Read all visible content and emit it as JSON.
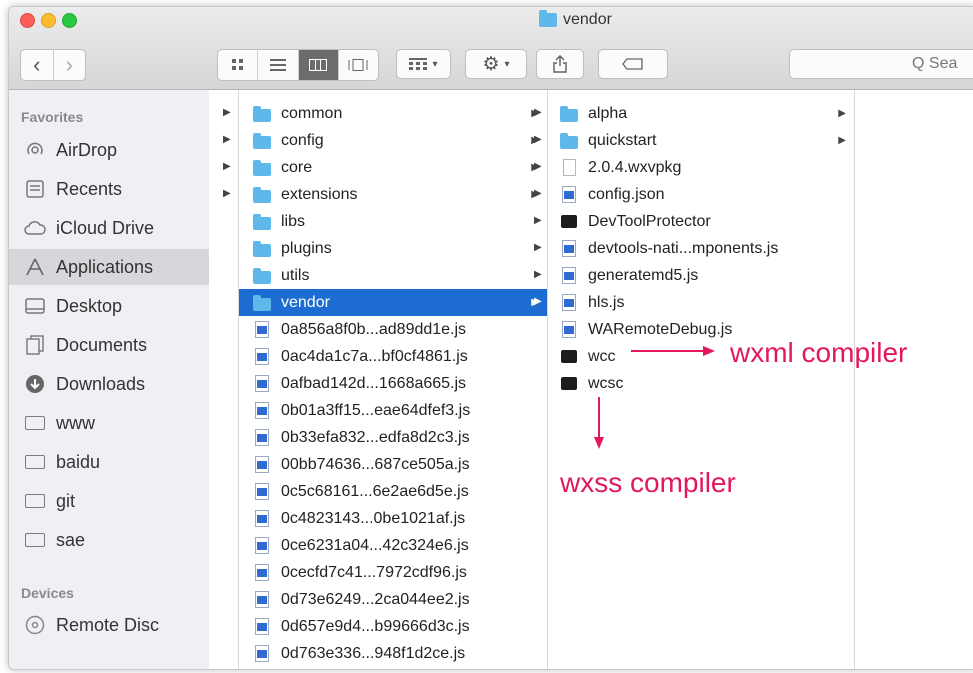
{
  "window": {
    "title": "vendor"
  },
  "toolbar": {
    "back_label": "‹",
    "forward_label": "›",
    "search_placeholder": "Q Sea"
  },
  "sidebar": {
    "favorites_header": "Favorites",
    "devices_header": "Devices",
    "items": [
      {
        "label": "AirDrop",
        "icon": "airdrop-icon"
      },
      {
        "label": "Recents",
        "icon": "recents-icon"
      },
      {
        "label": "iCloud Drive",
        "icon": "cloud-icon"
      },
      {
        "label": "Applications",
        "icon": "applications-icon",
        "selected": true
      },
      {
        "label": "Desktop",
        "icon": "desktop-icon"
      },
      {
        "label": "Documents",
        "icon": "documents-icon"
      },
      {
        "label": "Downloads",
        "icon": "downloads-icon"
      },
      {
        "label": "www",
        "icon": "folder-icon"
      },
      {
        "label": "baidu",
        "icon": "folder-icon"
      },
      {
        "label": "git",
        "icon": "folder-icon"
      },
      {
        "label": "sae",
        "icon": "folder-icon"
      }
    ],
    "devices": [
      {
        "label": "Remote Disc",
        "icon": "disc-icon"
      }
    ]
  },
  "column1": {
    "items": [
      {
        "name": "common",
        "kind": "folder",
        "has_children": true
      },
      {
        "name": "config",
        "kind": "folder",
        "has_children": true
      },
      {
        "name": "core",
        "kind": "folder",
        "has_children": true
      },
      {
        "name": "extensions",
        "kind": "folder",
        "has_children": true
      },
      {
        "name": "libs",
        "kind": "folder",
        "has_children": false
      },
      {
        "name": "plugins",
        "kind": "folder",
        "has_children": false
      },
      {
        "name": "utils",
        "kind": "folder",
        "has_children": false
      },
      {
        "name": "vendor",
        "kind": "folder",
        "has_children": false,
        "selected": true
      },
      {
        "name": "0a856a8f0b...ad89dd1e.js",
        "kind": "js"
      },
      {
        "name": "0ac4da1c7a...bf0cf4861.js",
        "kind": "js"
      },
      {
        "name": "0afbad142d...1668a665.js",
        "kind": "js"
      },
      {
        "name": "0b01a3ff15...eae64dfef3.js",
        "kind": "js"
      },
      {
        "name": "0b33efa832...edfa8d2c3.js",
        "kind": "js"
      },
      {
        "name": "00bb74636...687ce505a.js",
        "kind": "js"
      },
      {
        "name": "0c5c68161...6e2ae6d5e.js",
        "kind": "js"
      },
      {
        "name": "0c4823143...0be1021af.js",
        "kind": "js"
      },
      {
        "name": "0ce6231a04...42c324e6.js",
        "kind": "js"
      },
      {
        "name": "0cecfd7c41...7972cdf96.js",
        "kind": "js"
      },
      {
        "name": "0d73e6249...2ca044ee2.js",
        "kind": "js"
      },
      {
        "name": "0d657e9d4...b99666d3c.js",
        "kind": "js"
      },
      {
        "name": "0d763e336...948f1d2ce.js",
        "kind": "js"
      }
    ]
  },
  "column2": {
    "items": [
      {
        "name": "alpha",
        "kind": "folder",
        "has_children": true
      },
      {
        "name": "quickstart",
        "kind": "folder",
        "has_children": true
      },
      {
        "name": "2.0.4.wxvpkg",
        "kind": "file"
      },
      {
        "name": "config.json",
        "kind": "js"
      },
      {
        "name": "DevToolProtector",
        "kind": "exec"
      },
      {
        "name": "devtools-nati...mponents.js",
        "kind": "js"
      },
      {
        "name": "generatemd5.js",
        "kind": "js"
      },
      {
        "name": "hls.js",
        "kind": "js"
      },
      {
        "name": "WARemoteDebug.js",
        "kind": "js"
      },
      {
        "name": "wcc",
        "kind": "exec"
      },
      {
        "name": "wcsc",
        "kind": "exec"
      }
    ]
  },
  "annotations": {
    "wxml": "wxml compiler",
    "wxss": "wxss compiler",
    "color": "#e2185c"
  }
}
